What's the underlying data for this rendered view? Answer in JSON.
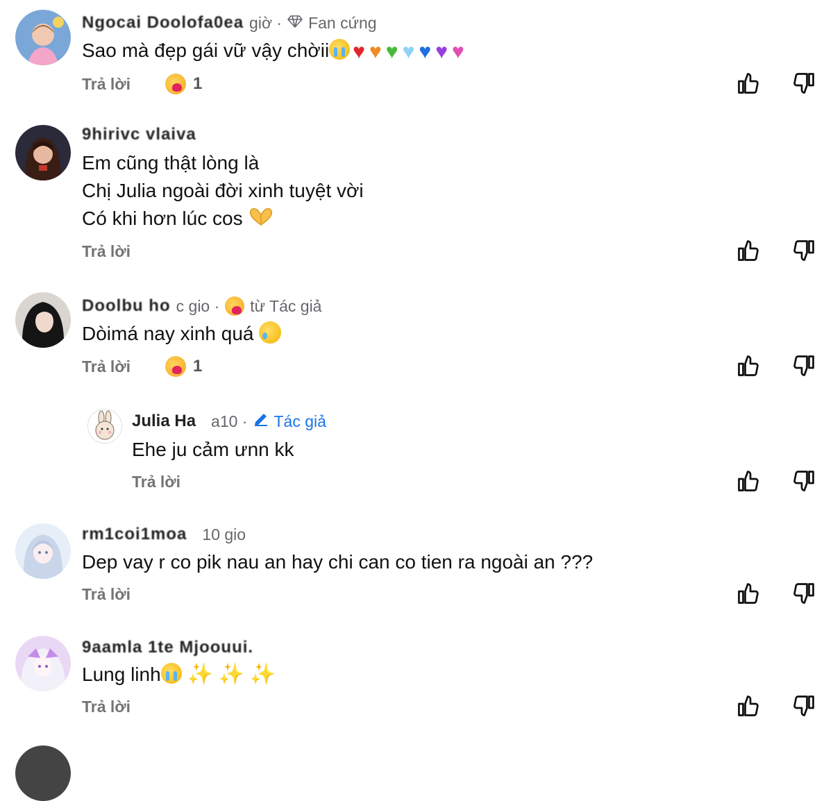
{
  "comments": [
    {
      "author": "Ngocai Doolofa0ea",
      "time": "giờ ·",
      "badge_label": "Fan cứng",
      "text_lines": [
        "Sao mà đẹp gái vữ vậy chờii"
      ],
      "reply_label": "Trả lời",
      "reaction_count": "1",
      "emojis_after": [
        "crying-face",
        "red-heart",
        "orange-heart",
        "green-heart",
        "light-blue-heart",
        "blue-heart",
        "purple-heart",
        "pink-heart"
      ]
    },
    {
      "author": "9hirivc vlaiva",
      "time": "",
      "text_lines": [
        "Em cũng thật lòng là",
        "Chị Julia ngoài đời xinh tuyệt vời",
        "Có khi hơn lúc cos"
      ],
      "reply_label": "Trả lời",
      "emojis_after": [
        "heart-hands"
      ]
    },
    {
      "author": "Doolbu ho",
      "time": "c gio ·",
      "author_react_label": "từ Tác giả",
      "text_lines": [
        "Dòimá nay xinh quá"
      ],
      "reply_label": "Trả lời",
      "reaction_count": "1",
      "emojis_after": [
        "face-holding-back-tears"
      ]
    },
    {
      "author": "Julia Ha",
      "time": "a10 ·",
      "author_tag_label": "Tác giả",
      "text_lines": [
        "Ehe ju cảm ưnn kk"
      ],
      "reply_label": "Trả lời"
    },
    {
      "author": "rm1coi1moa",
      "time": "10 gio",
      "text_lines": [
        "Dep vay r co pik nau an hay chi can co tien ra ngoài an ???"
      ],
      "reply_label": "Trả lời"
    },
    {
      "author": "9aamla 1te Mjoouui.",
      "time": "",
      "text_lines": [
        "Lung linh"
      ],
      "reply_label": "Trả lời",
      "emojis_after": [
        "crying-face",
        "sparkles",
        "sparkles",
        "sparkles"
      ]
    }
  ],
  "icons": {
    "like": "thumbs-up-icon",
    "dislike": "thumbs-down-icon",
    "badge": "diamond-icon",
    "author_tag": "pencil-icon"
  },
  "colors": {
    "meta_text": "#65676b",
    "author_tag": "#1b74e4",
    "reply": "#737373"
  }
}
